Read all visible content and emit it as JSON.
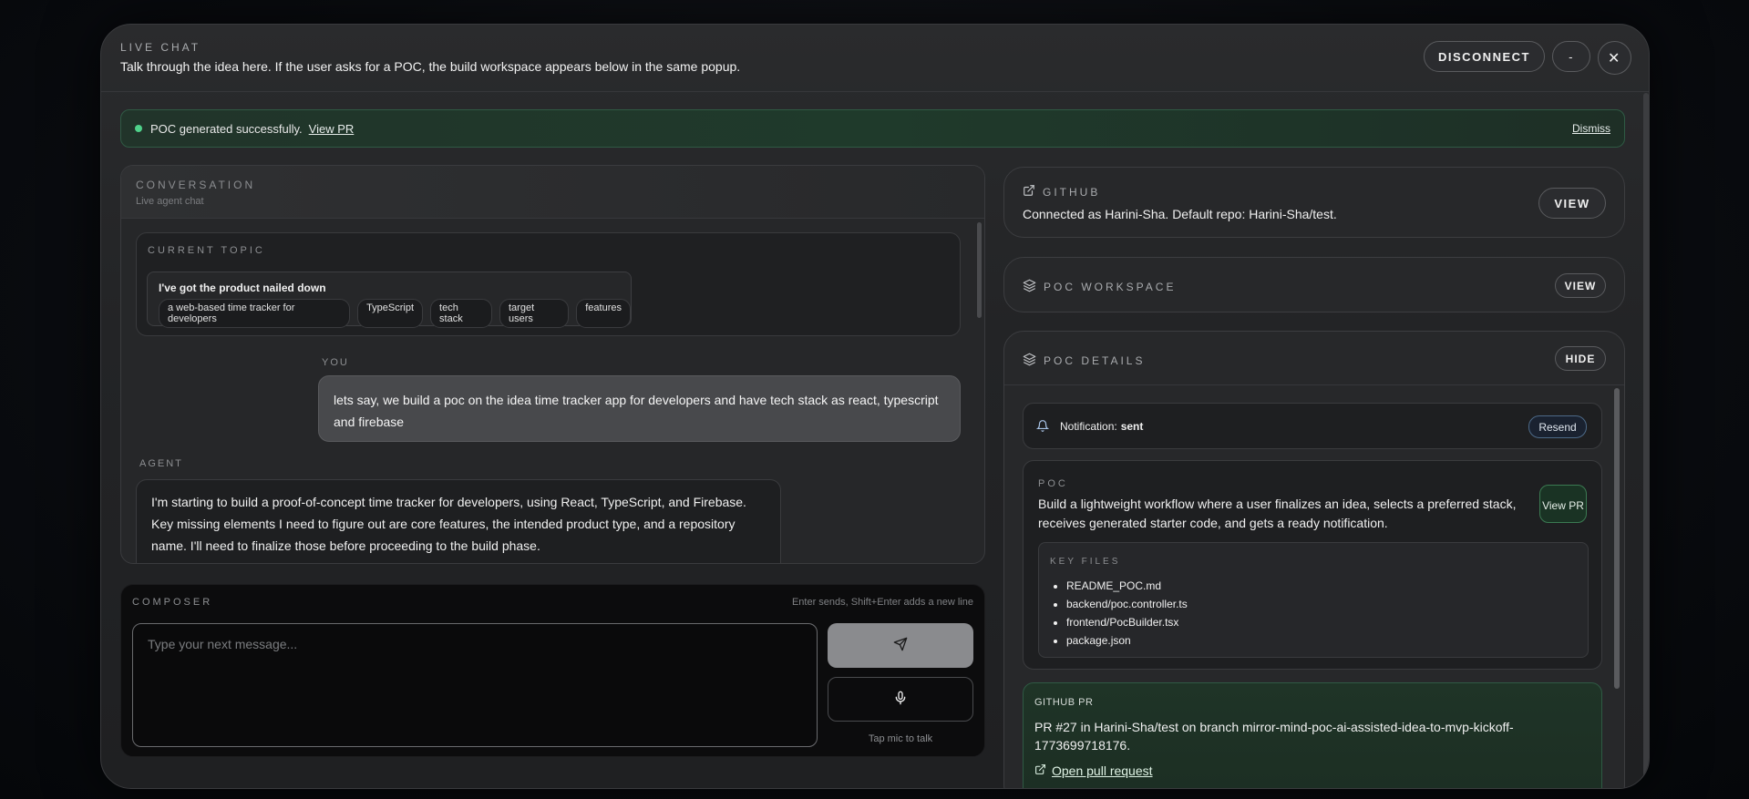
{
  "header": {
    "eyebrow": "LIVE CHAT",
    "subtitle": "Talk through the idea here. If the user asks for a POC, the build workspace appears below in the same popup.",
    "disconnect_label": "DISCONNECT",
    "minimize_label": "-",
    "close_label": "✕"
  },
  "banner": {
    "message": "POC generated successfully.",
    "link_label": "View PR",
    "dismiss_label": "Dismiss",
    "status_color": "#4fd18a"
  },
  "conversation": {
    "eyebrow": "CONVERSATION",
    "subtitle": "Live agent chat",
    "topic": {
      "eyebrow": "CURRENT TOPIC",
      "title": "I've got the product nailed down",
      "chips": [
        "a web-based time tracker for developers",
        "TypeScript",
        "tech stack",
        "target users",
        "features"
      ]
    },
    "messages": [
      {
        "role_label": "YOU",
        "text": "lets say, we build a poc on the idea time tracker app for developers and have tech stack as react, typescript and firebase"
      },
      {
        "role_label": "AGENT",
        "text": "I'm starting to build a proof-of-concept time tracker for developers, using React, TypeScript, and Firebase. Key missing elements I need to figure out are core features, the intended product type, and a repository name. I'll need to finalize those before proceeding to the build phase."
      }
    ]
  },
  "composer": {
    "eyebrow": "COMPOSER",
    "hint": "Enter sends, Shift+Enter adds a new line",
    "placeholder": "Type your next message...",
    "mic_hint": "Tap mic to talk"
  },
  "github": {
    "eyebrow": "GITHUB",
    "description": "Connected as Harini-Sha. Default repo: Harini-Sha/test.",
    "view_label": "VIEW"
  },
  "poc_workspace": {
    "eyebrow": "POC WORKSPACE",
    "view_label": "VIEW"
  },
  "poc_details": {
    "eyebrow": "POC DETAILS",
    "hide_label": "HIDE",
    "notification": {
      "label": "Notification:",
      "status": "sent",
      "resend_label": "Resend"
    },
    "poc": {
      "eyebrow": "POC",
      "description": "Build a lightweight workflow where a user finalizes an idea, selects a preferred stack, receives generated starter code, and gets a ready notification.",
      "view_pr_label": "View PR",
      "key_files_eyebrow": "KEY FILES",
      "key_files": [
        "README_POC.md",
        "backend/poc.controller.ts",
        "frontend/PocBuilder.tsx",
        "package.json"
      ]
    },
    "github_pr": {
      "eyebrow": "GITHUB PR",
      "description": "PR #27 in Harini-Sha/test on branch mirror-mind-poc-ai-assisted-idea-to-mvp-kickoff-1773699718176.",
      "link_label": "Open pull request"
    }
  }
}
